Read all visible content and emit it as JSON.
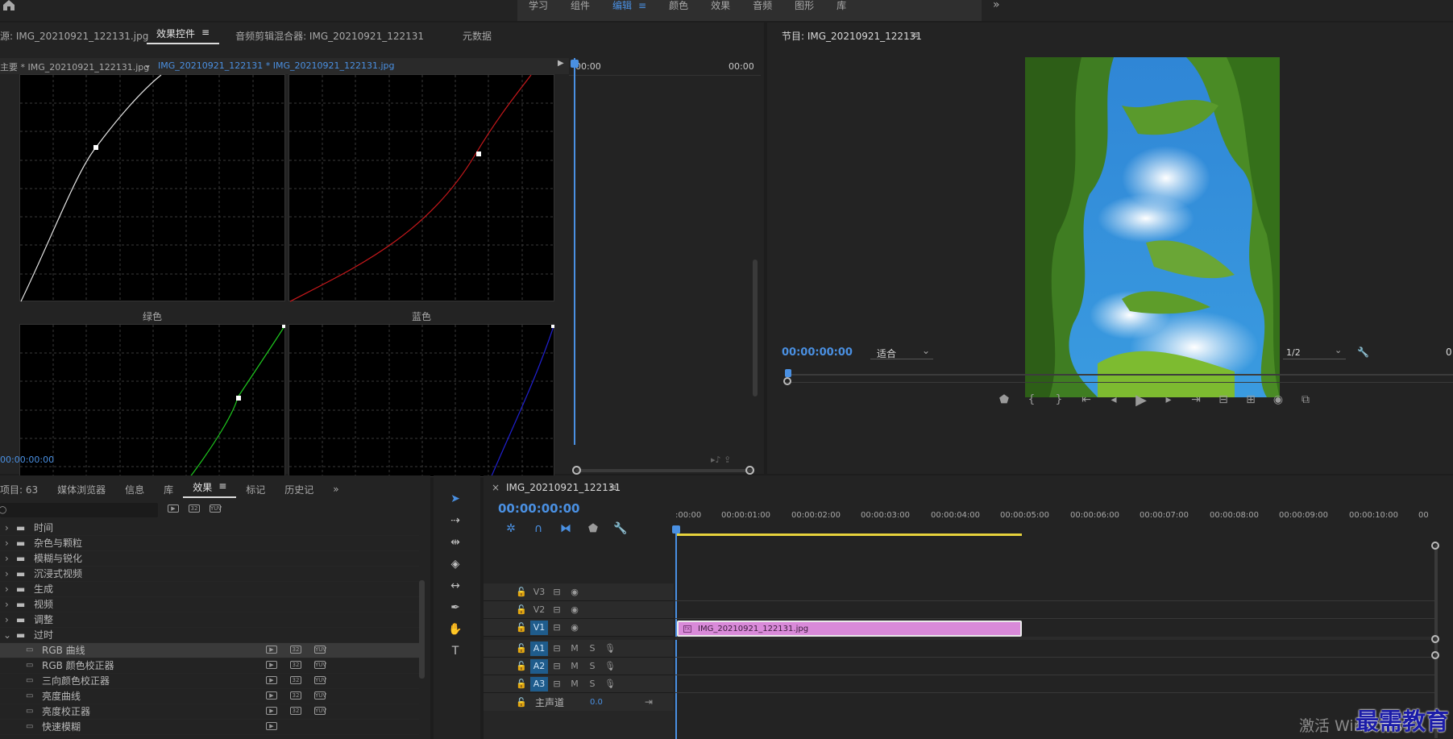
{
  "workspace_tabs": [
    {
      "label": "学习"
    },
    {
      "label": "组件"
    },
    {
      "label": "编辑",
      "menu": "≡"
    },
    {
      "label": "颜色"
    },
    {
      "label": "效果"
    },
    {
      "label": "音频"
    },
    {
      "label": "图形"
    },
    {
      "label": "库"
    }
  ],
  "workspace_more": "»",
  "source_panel": {
    "tabs": [
      {
        "label": "源: IMG_20210921_122131.jpg"
      },
      {
        "label": "效果控件",
        "menu": "≡"
      },
      {
        "label": "音频剪辑混合器: IMG_20210921_122131"
      },
      {
        "label": "元数据"
      }
    ],
    "master_clip": "主要 * IMG_20210921_122131.jpg",
    "sequence_clip": "IMG_20210921_122131 * IMG_20210921_122131.jpg",
    "ruler_start": "00:00",
    "ruler_end": "00:00",
    "timecode": "00:00:00:00",
    "green_label": "绿色",
    "blue_label": "蓝色"
  },
  "program_panel": {
    "title": "节目: IMG_20210921_122131",
    "menu": "≡",
    "timecode": "00:00:00:00",
    "fit": "适合",
    "resolution": "1/2",
    "extra": "0"
  },
  "project_panel": {
    "tabs": [
      {
        "label": "项目: 63"
      },
      {
        "label": "媒体浏览器"
      },
      {
        "label": "信息"
      },
      {
        "label": "库"
      },
      {
        "label": "效果",
        "menu": "≡"
      },
      {
        "label": "标记"
      },
      {
        "label": "历史记"
      }
    ],
    "more": "»",
    "folders": [
      {
        "label": "时间"
      },
      {
        "label": "杂色与颗粒"
      },
      {
        "label": "模糊与锐化"
      },
      {
        "label": "沉浸式视频"
      },
      {
        "label": "生成"
      },
      {
        "label": "视频"
      },
      {
        "label": "调整"
      },
      {
        "label": "过时"
      }
    ],
    "effects": [
      {
        "label": "RGB 曲线"
      },
      {
        "label": "RGB 颜色校正器"
      },
      {
        "label": "三向颜色校正器"
      },
      {
        "label": "亮度曲线"
      },
      {
        "label": "亮度校正器"
      },
      {
        "label": "快速模糊"
      }
    ]
  },
  "timeline": {
    "title": "IMG_20210921_122131",
    "menu": "≡",
    "close": "×",
    "timecode": "00:00:00:00",
    "ruler": [
      ":00:00",
      "00:00:01:00",
      "00:00:02:00",
      "00:00:03:00",
      "00:00:04:00",
      "00:00:05:00",
      "00:00:06:00",
      "00:00:07:00",
      "00:00:08:00",
      "00:00:09:00",
      "00:00:10:00",
      "00"
    ],
    "tracks": [
      {
        "name": "V3"
      },
      {
        "name": "V2"
      },
      {
        "name": "V1"
      },
      {
        "name": "A1",
        "m": "M",
        "s": "S"
      },
      {
        "name": "A2",
        "m": "M",
        "s": "S"
      },
      {
        "name": "A3",
        "m": "M",
        "s": "S"
      }
    ],
    "master": "主声道",
    "master_value": "0.0",
    "clip_name": "IMG_20210921_122131.jpg",
    "clip_color": "#d98ad9"
  },
  "watermark": {
    "activate": "激活 Windows",
    "brand": "最需教育"
  },
  "colors": {
    "accent": "#4a90e2",
    "red_curve": "#c8181b",
    "green_curve": "#1ec81e",
    "blue_curve": "#2020d0",
    "work_area": "#e6d23c"
  }
}
